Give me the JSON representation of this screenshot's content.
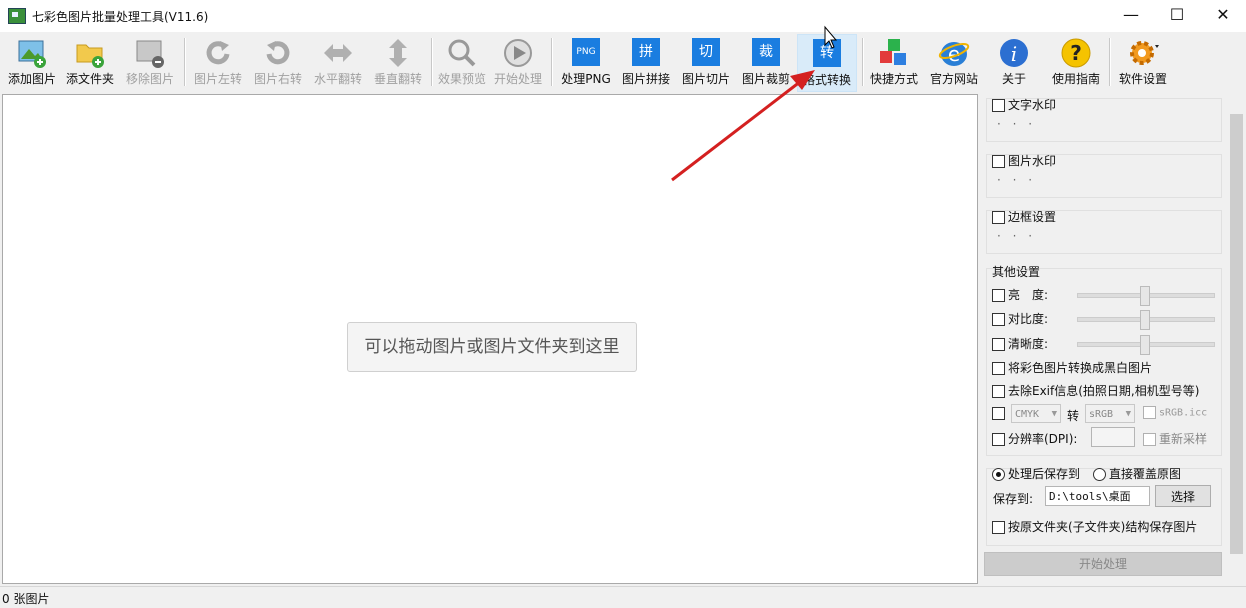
{
  "window": {
    "title": "七彩色图片批量处理工具(V11.6)",
    "min": "—",
    "max": "☐",
    "close": "✕"
  },
  "toolbar": {
    "add_image": "添加图片",
    "add_folder": "添文件夹",
    "remove_image": "移除图片",
    "rotate_left": "图片左转",
    "rotate_right": "图片右转",
    "flip_h": "水平翻转",
    "flip_v": "垂直翻转",
    "preview": "效果预览",
    "start": "开始处理",
    "process_png": "处理PNG",
    "png_glyph": "PNG",
    "stitch": "图片拼接",
    "stitch_glyph": "拼",
    "slice": "图片切片",
    "slice_glyph": "切",
    "crop": "图片裁剪",
    "crop_glyph": "裁",
    "convert": "格式转换",
    "convert_glyph": "转",
    "shortcut": "快捷方式",
    "website": "官方网站",
    "about": "关于",
    "guide": "使用指南",
    "settings": "软件设置"
  },
  "canvas": {
    "hint": "可以拖动图片或图片文件夹到这里"
  },
  "panel": {
    "text_watermark": "文字水印",
    "image_watermark": "图片水印",
    "border": "边框设置",
    "dots": "· · ·",
    "other": "其他设置",
    "brightness": "亮　度:",
    "contrast": "对比度:",
    "sharpness": "清晰度:",
    "grayscale": "将彩色图片转换成黑白图片",
    "exif": "去除Exif信息(拍照日期,相机型号等)",
    "cmyk": "CMYK",
    "convert_to": "转",
    "srgb": "sRGB",
    "icc": "sRGB.icc",
    "dpi": "分辨率(DPI):",
    "resample": "重新采样",
    "save_after": "处理后保存到",
    "overwrite": "直接覆盖原图",
    "save_to_label": "保存到:",
    "save_path": "D:\\tools\\桌面",
    "choose": "选择",
    "keep_structure": "按原文件夹(子文件夹)结构保存图片",
    "start_button": "开始处理"
  },
  "status": {
    "count": "0 张图片"
  },
  "colors": {
    "accent_blue": "#1a7de0",
    "arrow_red": "#d42020"
  }
}
